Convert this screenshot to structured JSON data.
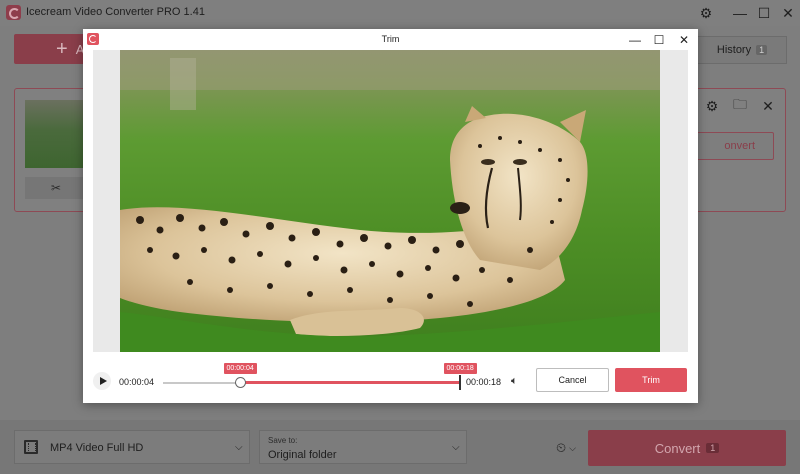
{
  "app": {
    "title": "Icecream Video Converter PRO 1.41",
    "window_controls": {
      "minimize": "—",
      "maximize": "☐",
      "close": "✕"
    }
  },
  "toolbar": {
    "add_button_glyph": "+",
    "add_button_label": "A",
    "history_label": "History",
    "history_count": "1"
  },
  "file_card": {
    "convert_label": "onvert",
    "trim_icon_glyph": "✂"
  },
  "bottom": {
    "format_label": "MP4 Video Full HD",
    "save_caption": "Save to:",
    "save_value": "Original folder",
    "convert_label": "Convert",
    "convert_count": "1"
  },
  "dialog": {
    "title": "Trim",
    "current_time": "00:00:04",
    "end_time": "00:00:18",
    "start_marker": "00:00:04",
    "end_marker": "00:00:18",
    "start_fraction": 0.2593,
    "end_fraction": 1.0,
    "cancel_label": "Cancel",
    "trim_label": "Trim"
  },
  "colors": {
    "accent": "#e0535f",
    "accent_dimmed": "#8a3e4a",
    "overlay_gray": "#7e7e7e"
  },
  "icons": [
    "app-logo-icon",
    "settings-icon",
    "minimize-icon",
    "maximize-icon",
    "close-icon",
    "plus-icon",
    "gear-icon",
    "folder-icon",
    "scissors-icon",
    "film-icon",
    "chevron-down-icon",
    "clock-icon",
    "play-icon",
    "speaker-icon"
  ]
}
